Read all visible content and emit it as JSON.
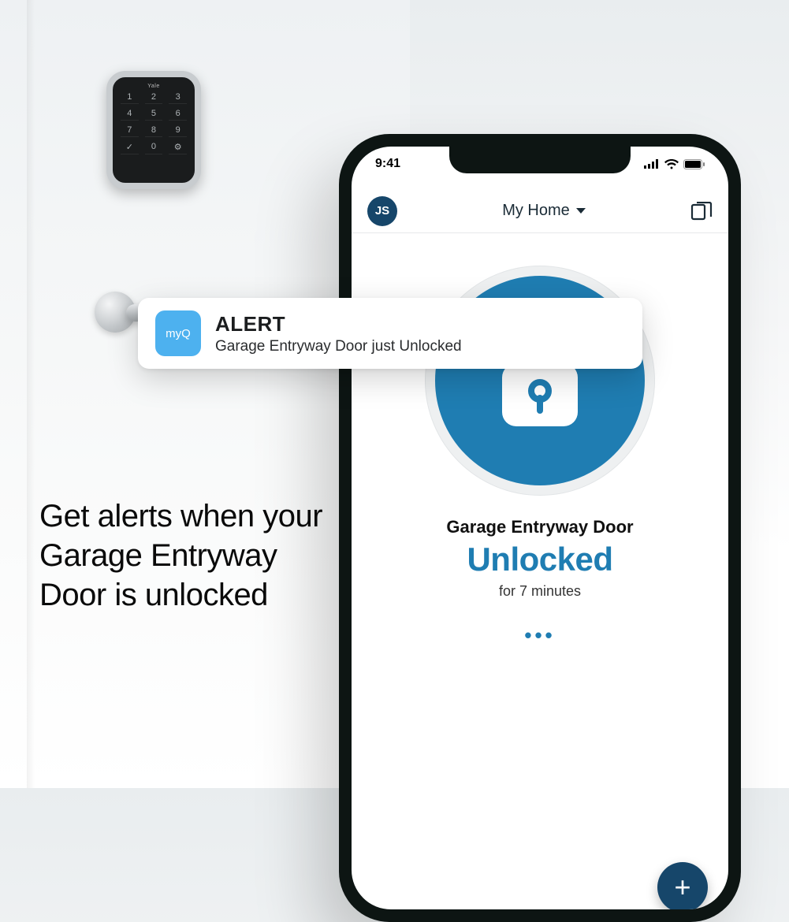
{
  "background": {
    "keypad_brand": "Yale",
    "keys": [
      "1",
      "2",
      "3",
      "4",
      "5",
      "6",
      "7",
      "8",
      "9",
      "✓",
      "0",
      "⚙"
    ]
  },
  "caption": "Get alerts when your Garage Entryway Door is unlocked",
  "status_bar": {
    "time": "9:41"
  },
  "header": {
    "avatar_initials": "JS",
    "home_label": "My Home"
  },
  "device": {
    "name": "Garage Entryway Door",
    "status": "Unlocked",
    "duration": "for 7 minutes"
  },
  "fab": {
    "label": "+"
  },
  "toast": {
    "app": "myQ",
    "title": "ALERT",
    "message": "Garage Entryway Door just Unlocked"
  }
}
